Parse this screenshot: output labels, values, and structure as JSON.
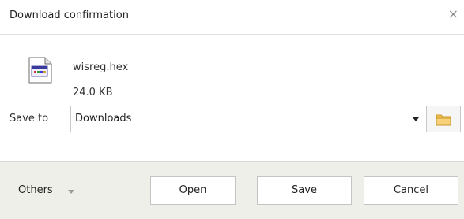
{
  "dialog": {
    "title": "Download confirmation",
    "close_icon": "close-icon"
  },
  "file": {
    "icon": "hex-file-icon",
    "name": "wisreg.hex",
    "size": "24.0 KB"
  },
  "save_to": {
    "label": "Save to",
    "selected": "Downloads",
    "folder_icon": "folder-icon"
  },
  "footer": {
    "others_label": "Others",
    "buttons": {
      "open": "Open",
      "save": "Save",
      "cancel": "Cancel"
    }
  },
  "colors": {
    "footer_bg": "#efefea",
    "folder": "#f2c14e"
  }
}
